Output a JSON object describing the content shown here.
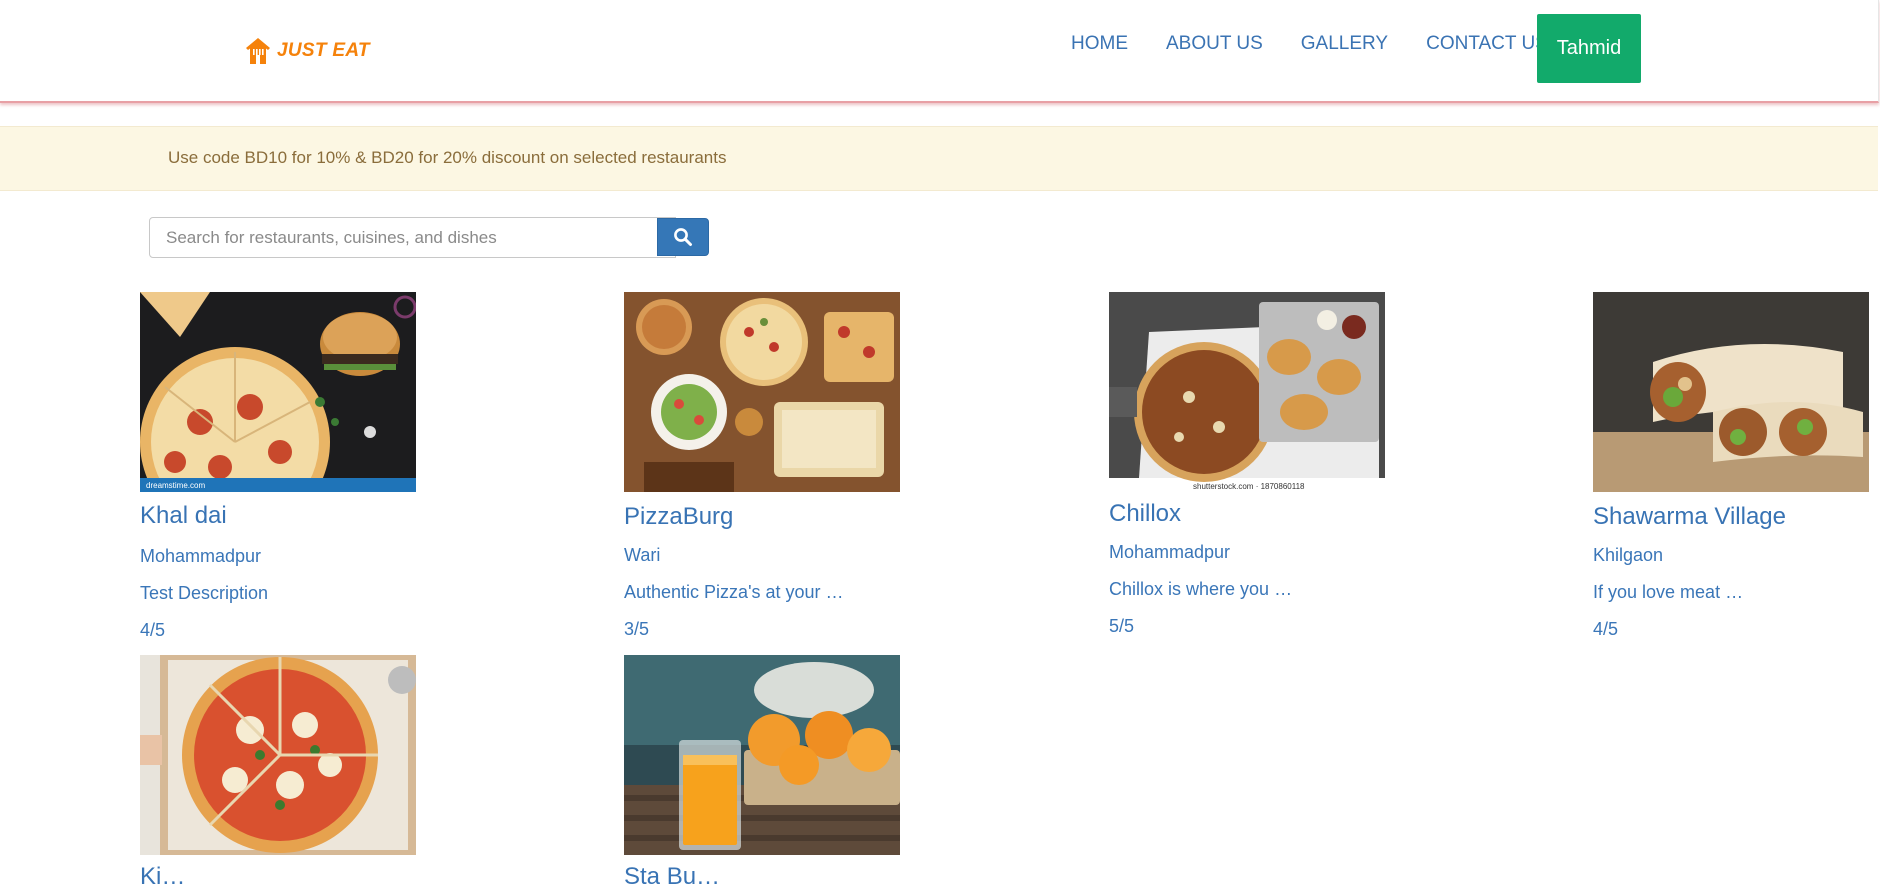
{
  "header": {
    "logo_text": "JUST EAT",
    "nav": [
      "HOME",
      "ABOUT US",
      "GALLERY",
      "CONTACT US"
    ],
    "user_label": "Tahmid"
  },
  "promo": {
    "text": "Use code BD10 for 10% & BD20 for 20% discount on selected restaurants"
  },
  "search": {
    "placeholder": "Search for restaurants, cuisines, and dishes",
    "value": ""
  },
  "restaurants": [
    {
      "name": "Khal dai",
      "area": "Mohammadpur",
      "description": "Test Description",
      "rating": "4/5",
      "image": "pizza-and-burger-photo",
      "image_credit": "dreamstime.com"
    },
    {
      "name": "PizzaBurg",
      "area": "Wari",
      "description": "Authentic Pizza's at your …",
      "rating": "3/5",
      "image": "pizza-spread-table-photo"
    },
    {
      "name": "Chillox",
      "area": "Mohammadpur",
      "description": "Chillox is where you …",
      "rating": "5/5",
      "image": "burger-platter-photo",
      "image_credit": "shutterstock.com · 1870860118"
    },
    {
      "name": "Shawarma Village",
      "area": "Khilgaon",
      "description": "If you love meat …",
      "rating": "4/5",
      "image": "shawarma-wraps-photo"
    },
    {
      "name": "Ki…",
      "area": "",
      "description": "",
      "rating": "",
      "image": "margherita-pizza-photo"
    },
    {
      "name": "Sta Bu…",
      "area": "",
      "description": "",
      "rating": "",
      "image": "orange-juice-photo"
    }
  ],
  "colors": {
    "brand": "#f5820b",
    "nav_link": "#3a73b3",
    "user_button": "#12aa6b",
    "promo_bg": "#fcf7e3",
    "promo_text": "#8a6d3b",
    "search_button": "#3577b7"
  }
}
